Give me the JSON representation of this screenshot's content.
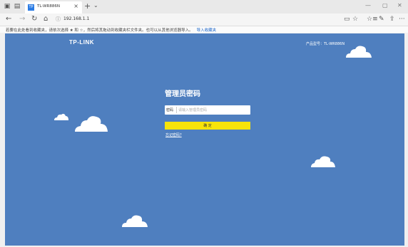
{
  "titlebar": {
    "tab_title": "TL-WR886N",
    "tab_favicon_text": "TP",
    "close_glyph": "×",
    "newtab_glyph": "+",
    "tabmenu_glyph": "⌄",
    "min_glyph": "—",
    "max_glyph": "▢",
    "winclose_glyph": "✕"
  },
  "navbar": {
    "back_glyph": "←",
    "forward_glyph": "→",
    "refresh_glyph": "↻",
    "home_glyph": "⌂",
    "url": "192.168.1.1",
    "url_icon": "ⓘ",
    "reading_glyph": "▭",
    "favorite_glyph": "☆",
    "favbar_glyph": "☆≡",
    "notes_glyph": "✎",
    "share_glyph": "⇪",
    "more_glyph": "···"
  },
  "favbar": {
    "text": "若要在此处看到收藏夹，请依次选择 ★ 和 ☆，然后将其拖动到收藏夹栏文件夹。也可以从其他浏览器导入。",
    "link": "导入收藏夹"
  },
  "page": {
    "logo": "TP-LINK",
    "product": "产品型号：TL-WR886N",
    "heading": "管理员密码",
    "password_label": "密码",
    "password_placeholder": "请输入管理员密码",
    "confirm_label": "确 定",
    "forgot_link": "忘记密码?",
    "background_color": "#4f7fbf",
    "button_color": "#f7e40a"
  }
}
